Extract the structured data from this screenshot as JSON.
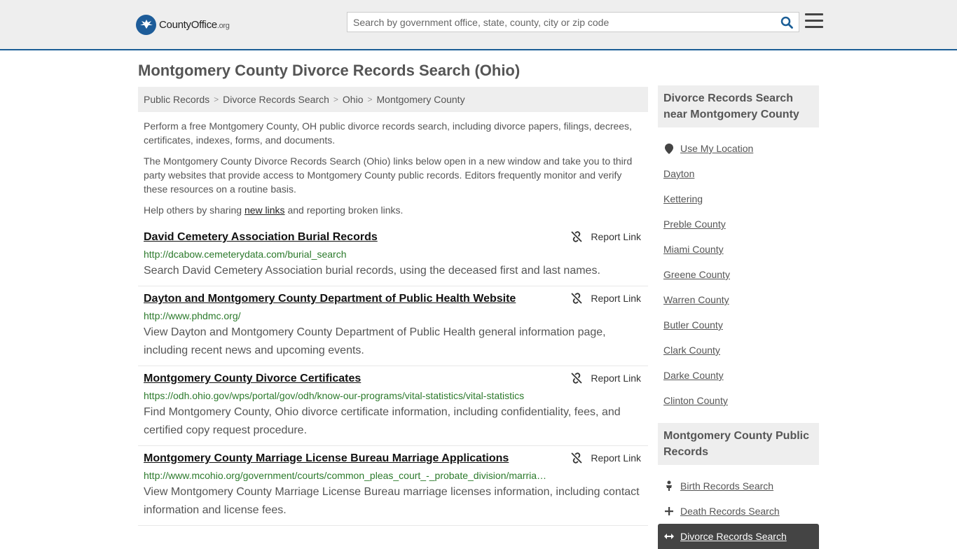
{
  "header": {
    "logo_name": "CountyOffice",
    "logo_tld": ".org",
    "search_placeholder": "Search by government office, state, county, city or zip code"
  },
  "page_title": "Montgomery County Divorce Records Search (Ohio)",
  "breadcrumb": [
    "Public Records",
    "Divorce Records Search",
    "Ohio",
    "Montgomery County"
  ],
  "intro": {
    "p1": "Perform a free Montgomery County, OH public divorce records search, including divorce papers, filings, decrees, certificates, indexes, forms, and documents.",
    "p2": "The Montgomery County Divorce Records Search (Ohio) links below open in a new window and take you to third party websites that provide access to Montgomery County public records. Editors frequently monitor and verify these resources on a routine basis.",
    "p3_before": "Help others by sharing ",
    "p3_link": "new links",
    "p3_after": " and reporting broken links."
  },
  "report_label": "Report Link",
  "results": [
    {
      "title": "David Cemetery Association Burial Records",
      "url": "http://dcabow.cemeterydata.com/burial_search",
      "desc": "Search David Cemetery Association burial records, using the deceased first and last names."
    },
    {
      "title": "Dayton and Montgomery County Department of Public Health Website",
      "url": "http://www.phdmc.org/",
      "desc": "View Dayton and Montgomery County Department of Public Health general information page, including recent news and upcoming events."
    },
    {
      "title": "Montgomery County Divorce Certificates",
      "url": "https://odh.ohio.gov/wps/portal/gov/odh/know-our-programs/vital-statistics/vital-statistics",
      "desc": "Find Montgomery County, Ohio divorce certificate information, including confidentiality, fees, and certified copy request procedure."
    },
    {
      "title": "Montgomery County Marriage License Bureau Marriage Applications",
      "url": "http://www.mcohio.org/government/courts/common_pleas_court_-_probate_division/marria…",
      "desc": "View Montgomery County Marriage License Bureau marriage licenses information, including contact information and license fees."
    }
  ],
  "sidebar": {
    "nearby_heading": "Divorce Records Search near Montgomery County",
    "use_location": "Use My Location",
    "nearby": [
      "Dayton",
      "Kettering",
      "Preble County",
      "Miami County",
      "Greene County",
      "Warren County",
      "Butler County",
      "Clark County",
      "Darke County",
      "Clinton County"
    ],
    "public_heading": "Montgomery County Public Records",
    "public": [
      {
        "label": "Birth Records Search",
        "icon": "baby-icon"
      },
      {
        "label": "Death Records Search",
        "icon": "cross-icon"
      },
      {
        "label": "Divorce Records Search",
        "icon": "arrows-icon"
      }
    ]
  }
}
